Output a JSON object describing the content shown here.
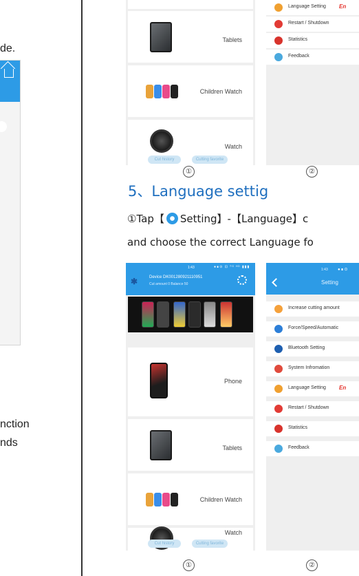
{
  "left_fragment": {
    "line_top": "de.",
    "line_mid1": "nction",
    "line_mid2": "nds"
  },
  "top_section": {
    "products": [
      {
        "label": "Tablets"
      },
      {
        "label": "Children Watch"
      },
      {
        "label": "Watch"
      }
    ],
    "tabs": [
      "Cut history",
      "Cutting favorite"
    ],
    "settings_items": [
      {
        "label": "Language Setting",
        "value": "En"
      },
      {
        "label": "Restart / Shutdown"
      },
      {
        "label": "Statistics"
      },
      {
        "label": "Feedback"
      }
    ],
    "markers": [
      "①",
      "②"
    ]
  },
  "section5": {
    "heading": "5、Language settig",
    "line1_pre": "①Tap【",
    "line1_post": "Setting】-【Language】c",
    "line2": "and choose the correct Language fo"
  },
  "bottom_section": {
    "status_time": "1:43",
    "status_icons": "●∎⊙ ⊡ ⁰ᴳ ᴴᴰ ▮▮▮",
    "device_line": "Device  DK001280921110951",
    "stats_line": "Cut amount    0      Balance    50",
    "products": [
      {
        "label": "Phone"
      },
      {
        "label": "Tablets"
      },
      {
        "label": "Children Watch"
      },
      {
        "label": "Watch"
      }
    ],
    "tabs": [
      "Cut history",
      "Cutting favorite"
    ],
    "settings_title": "Setting",
    "settings_time": "1:43",
    "settings_items": [
      {
        "label": "Increase cutting amount",
        "color": "#f5a13b"
      },
      {
        "label": "Force/Speed/Automatic",
        "color": "#2d7fd8"
      },
      {
        "label": "Bluetooth Setting",
        "color": "#1e5fb0"
      },
      {
        "label": "System Infromation",
        "color": "#e04a3c"
      },
      {
        "label": "Language Setting",
        "color": "#f0a030",
        "value": "En"
      },
      {
        "label": "Restart / Shutdown",
        "color": "#e23b35"
      },
      {
        "label": "Statistics",
        "color": "#d8332c"
      },
      {
        "label": "Feedback",
        "color": "#4aa9de"
      }
    ],
    "markers": [
      "①",
      "②"
    ]
  },
  "colors": {
    "accent": "#2d9be6",
    "heading": "#1f6fbf",
    "en_value": "#e4312b"
  }
}
